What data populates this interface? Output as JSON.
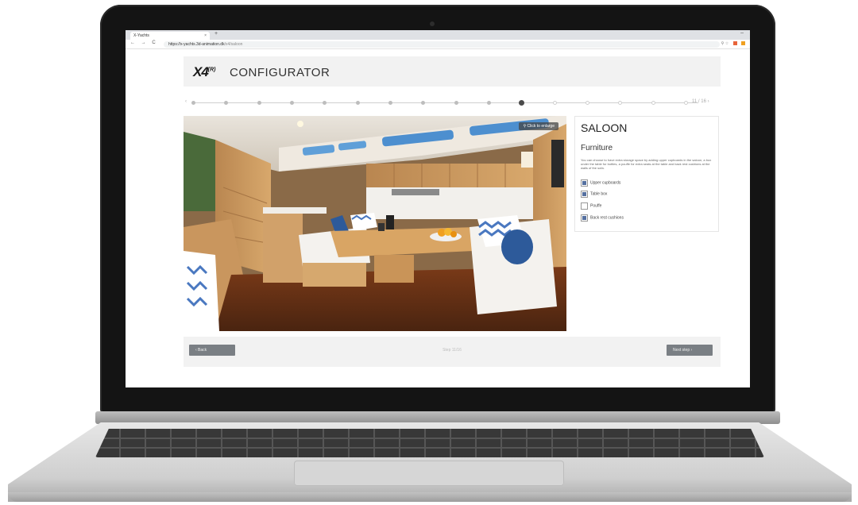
{
  "browser": {
    "tab_title": "X-Yachts",
    "tab_close": "×",
    "new_tab": "+",
    "window_min": "–",
    "nav": "← → C",
    "url_host": "https://x-yachts.3d-animation.dk",
    "url_path": "/x4/saloon",
    "toolbar_icons": "⚲ ☆"
  },
  "header": {
    "logo": "X4",
    "logo_sup": "(R)",
    "title": "CONFIGURATOR"
  },
  "progress": {
    "total_steps": 16,
    "completed": 10,
    "current": 11,
    "step_count": "11 / 16 ›",
    "prev_arrow": "‹"
  },
  "viewer": {
    "enlarge_label": "⚲ Click to enlarge"
  },
  "panel": {
    "title": "SALOON",
    "subtitle": "Furniture",
    "description": "You can choose to have extra storage space by adding upper cupboards in the saloon, a box under the table for bottles, a pouffe for extra seats at the table and back rest cushions at the walls of the sofa.",
    "options": [
      {
        "label": "Upper cupboards",
        "checked": true
      },
      {
        "label": "Table box",
        "checked": true
      },
      {
        "label": "Pouffe",
        "checked": false
      },
      {
        "label": "Back rest cushions",
        "checked": true
      }
    ]
  },
  "footer": {
    "back_label": "‹   Back",
    "step_text": "Step 11/16",
    "next_label": "Next step   ›"
  },
  "colors": {
    "checkbox_fill": "#5570a0",
    "button_bg": "#7a7f84",
    "header_bg": "#f2f2f2"
  }
}
